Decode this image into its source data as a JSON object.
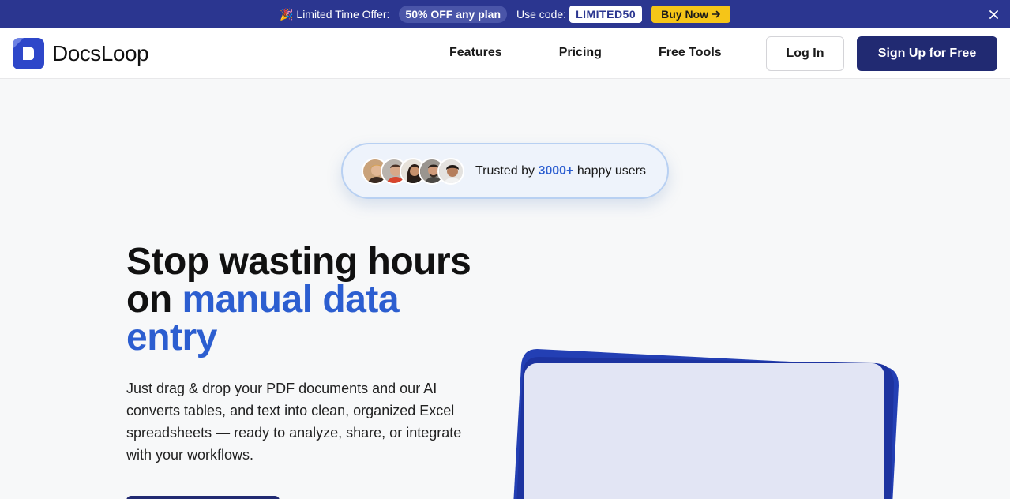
{
  "promo": {
    "party_emoji": "🎉",
    "offer_text": "Limited Time Offer:",
    "discount_pill": "50% OFF any plan",
    "use_code_label": "Use code:",
    "code": "LIMITED50",
    "buy_label": "Buy Now",
    "buy_icon": "arrow-right-icon",
    "close_icon": "close-icon",
    "colors": {
      "bar": "#2b3690",
      "button": "#f5c518"
    }
  },
  "header": {
    "logo_text": "DocsLoop",
    "nav": [
      "Features",
      "Pricing",
      "Free Tools"
    ],
    "login_label": "Log In",
    "signup_label": "Sign Up for Free",
    "colors": {
      "primary": "#212a72"
    }
  },
  "trust": {
    "prefix": "Trusted by",
    "count": "3000+",
    "suffix": "happy users",
    "avatar_count": 5
  },
  "hero": {
    "headline_line1": "Stop wasting hours",
    "headline_on": "on",
    "headline_accent": "manual data entry",
    "subcopy": "Just drag & drop your PDF documents and our AI converts tables, and text into clean, organized Excel spreadsheets — ready to analyze, share, or integrate with your workflows.",
    "colors": {
      "accent": "#2c5ed0"
    }
  }
}
